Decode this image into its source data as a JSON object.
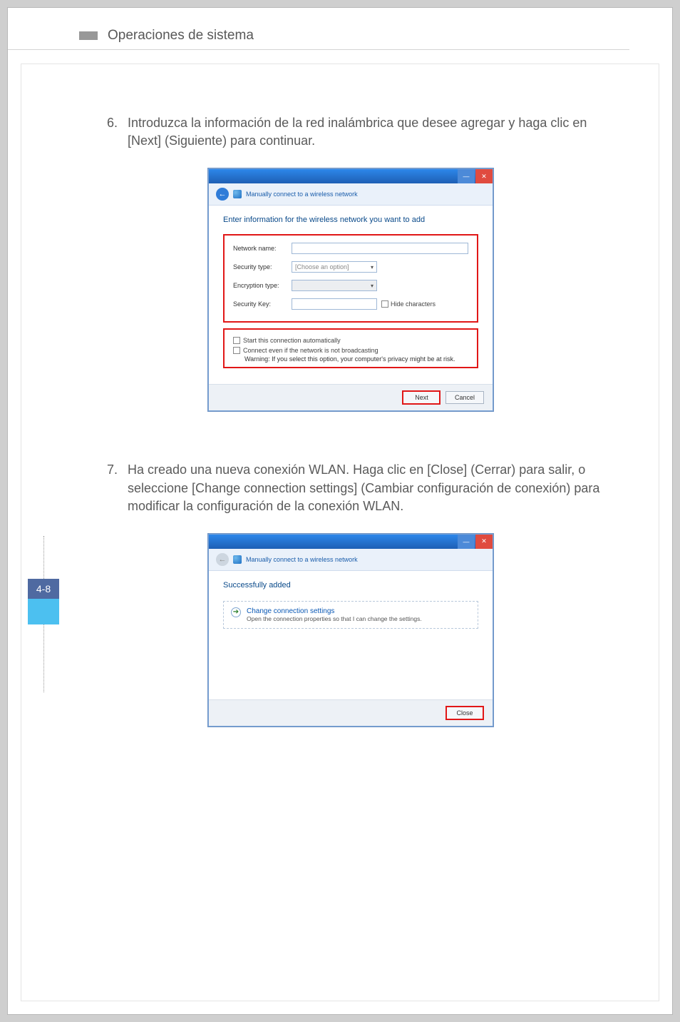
{
  "header": {
    "title": "Operaciones de sistema"
  },
  "page_number": "4-8",
  "steps": {
    "s6": {
      "num": "6.",
      "text": "Introduzca la información de la red inalámbrica que desee agregar y haga clic en [Next] (Siguiente) para continuar."
    },
    "s7": {
      "num": "7.",
      "text": "Ha creado una nueva conexión WLAN. Haga clic en [Close] (Cerrar) para salir, o seleccione [Change connection settings] (Cambiar configuración de conexión) para modificar la configuración de la conexión WLAN."
    }
  },
  "wizard1": {
    "nav_title": "Manually connect to a wireless network",
    "heading": "Enter information for the wireless network you want to add",
    "labels": {
      "network_name": "Network name:",
      "security_type": "Security type:",
      "encryption_type": "Encryption type:",
      "security_key": "Security Key:"
    },
    "placeholder_sec": "[Choose an option]",
    "hide_chars": "Hide characters",
    "chk_auto": "Start this connection automatically",
    "chk_broadcast": "Connect even if the network is not broadcasting",
    "warning": "Warning: If you select this option, your computer's privacy might be at risk.",
    "btn_next": "Next",
    "btn_cancel": "Cancel"
  },
  "wizard2": {
    "nav_title": "Manually connect to a wireless network",
    "heading": "Successfully added",
    "link_title": "Change connection settings",
    "link_sub": "Open the connection properties so that I can change the settings.",
    "btn_close": "Close"
  }
}
